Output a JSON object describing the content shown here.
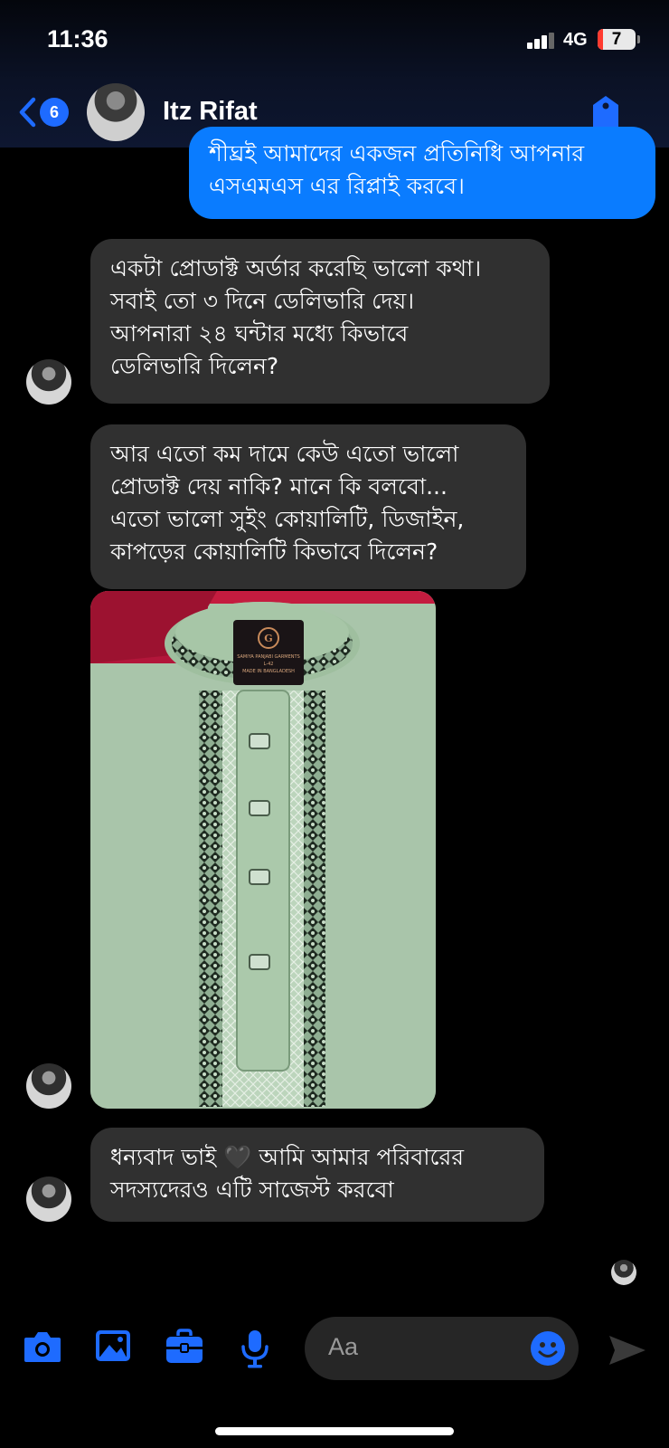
{
  "status_bar": {
    "time": "11:36",
    "network": "4G",
    "battery": "7"
  },
  "header": {
    "back_count": "6",
    "contact_name": "Itz Rifat"
  },
  "messages": {
    "outgoing_partial": {
      "lines": [
        "শীঘ্রই আমাদের একজন প্রতিনিধি আপনার",
        "এসএমএস এর রিপ্লাই করবে।"
      ]
    },
    "incoming_1": {
      "lines": [
        "একটা প্রোডাক্ট অর্ডার করেছি ভালো কথা।",
        "সবাই তো ৩ দিনে ডেলিভারি দেয়।",
        "আপনারা ২৪ ঘন্টার মধ্যে কিভাবে",
        "ডেলিভারি দিলেন?"
      ]
    },
    "incoming_2": {
      "lines": [
        "আর এতো কম দামে কেউ এতো ভালো",
        "প্রোডাক্ট দেয় নাকি? মানে কি বলবো...",
        "এতো ভালো সুইং কোয়ালিটি, ডিজাইন,",
        "কাপড়ের কোয়ালিটি কিভাবে দিলেন?"
      ]
    },
    "incoming_3": {
      "lines": [
        "ধন্যবাদ ভাই 🖤 আমি আমার পরিবারের",
        "সদস্যদেরও এটি সাজেস্ট করবো"
      ]
    },
    "photo_label": {
      "line1": "SAMIYA PANJABI GARMENTS",
      "line2": "L-42",
      "line3": "MADE IN BANGLADESH"
    }
  },
  "composer": {
    "placeholder": "Aa"
  },
  "icons": {
    "back": "chevron-left-icon",
    "tag": "tag-icon",
    "camera": "camera-icon",
    "gallery": "image-icon",
    "briefcase": "briefcase-icon",
    "mic": "microphone-icon",
    "emoji": "smiley-icon",
    "send": "send-icon"
  },
  "colors": {
    "accent": "#1e6bff",
    "outgoing_bubble": "#0a7cff",
    "incoming_bubble": "#303030"
  }
}
